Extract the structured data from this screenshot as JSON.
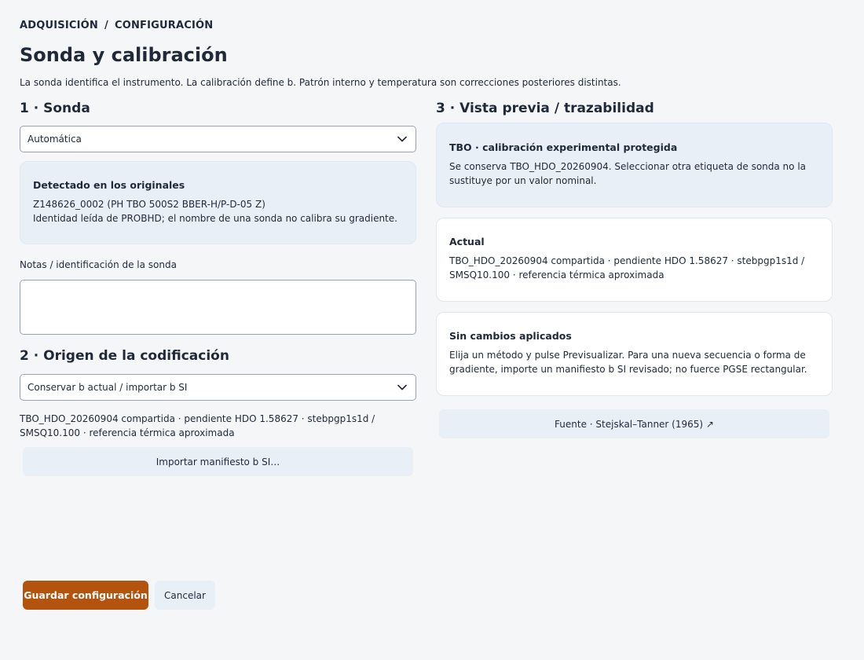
{
  "breadcrumb": {
    "parent": "ADQUISICIÓN",
    "separator": "/",
    "current": "CONFIGURACIÓN"
  },
  "page": {
    "title": "Sonda y calibración",
    "subtitle": "La sonda identifica el instrumento. La calibración define b. Patrón interno y temperatura son correcciones posteriores distintas."
  },
  "probe_section": {
    "title": "1 · Sonda",
    "select_value": "Automática",
    "detected": {
      "title": "Detectado en los originales",
      "line1": "Z148626_0002 (PH TBO 500S2 BBER-H/P-D-05 Z)",
      "line2": "Identidad leída de PROBHD; el nombre de una sonda no calibra su gradiente."
    },
    "notes_label": "Notas / identificación de la sonda",
    "notes_value": ""
  },
  "encoding_section": {
    "title": "2 · Origen de la codificación",
    "select_value": "Conservar b actual / importar b SI",
    "description": "TBO_HDO_20260904 compartida · pendiente HDO 1.58627 · stebpgp1s1d / SMSQ10.100 · referencia térmica aproximada",
    "import_button": "Importar manifiesto b SI…"
  },
  "preview_section": {
    "title": "3 · Vista previa / trazabilidad",
    "protected": {
      "title": "TBO · calibración experimental protegida",
      "text": "Se conserva TBO_HDO_20260904. Seleccionar otra etiqueta de sonda no la sustituye por un valor nominal."
    },
    "current": {
      "title": "Actual",
      "text": "TBO_HDO_20260904 compartida · pendiente HDO 1.58627 · stebpgp1s1d / SMSQ10.100 · referencia térmica aproximada"
    },
    "no_changes": {
      "title": "Sin cambios aplicados",
      "text": "Elija un método y pulse Previsualizar. Para una nueva secuencia o forma de gradiente, importe un manifiesto b SI revisado; no fuerce PGSE rectangular."
    },
    "source_button": "Fuente · Stejskal–Tanner (1965) ↗"
  },
  "actions": {
    "save": "Guardar configuración",
    "cancel": "Cancelar"
  },
  "colors": {
    "primary": "#b4530e",
    "panel_info": "#e9eff7",
    "text": "#1f2937"
  }
}
